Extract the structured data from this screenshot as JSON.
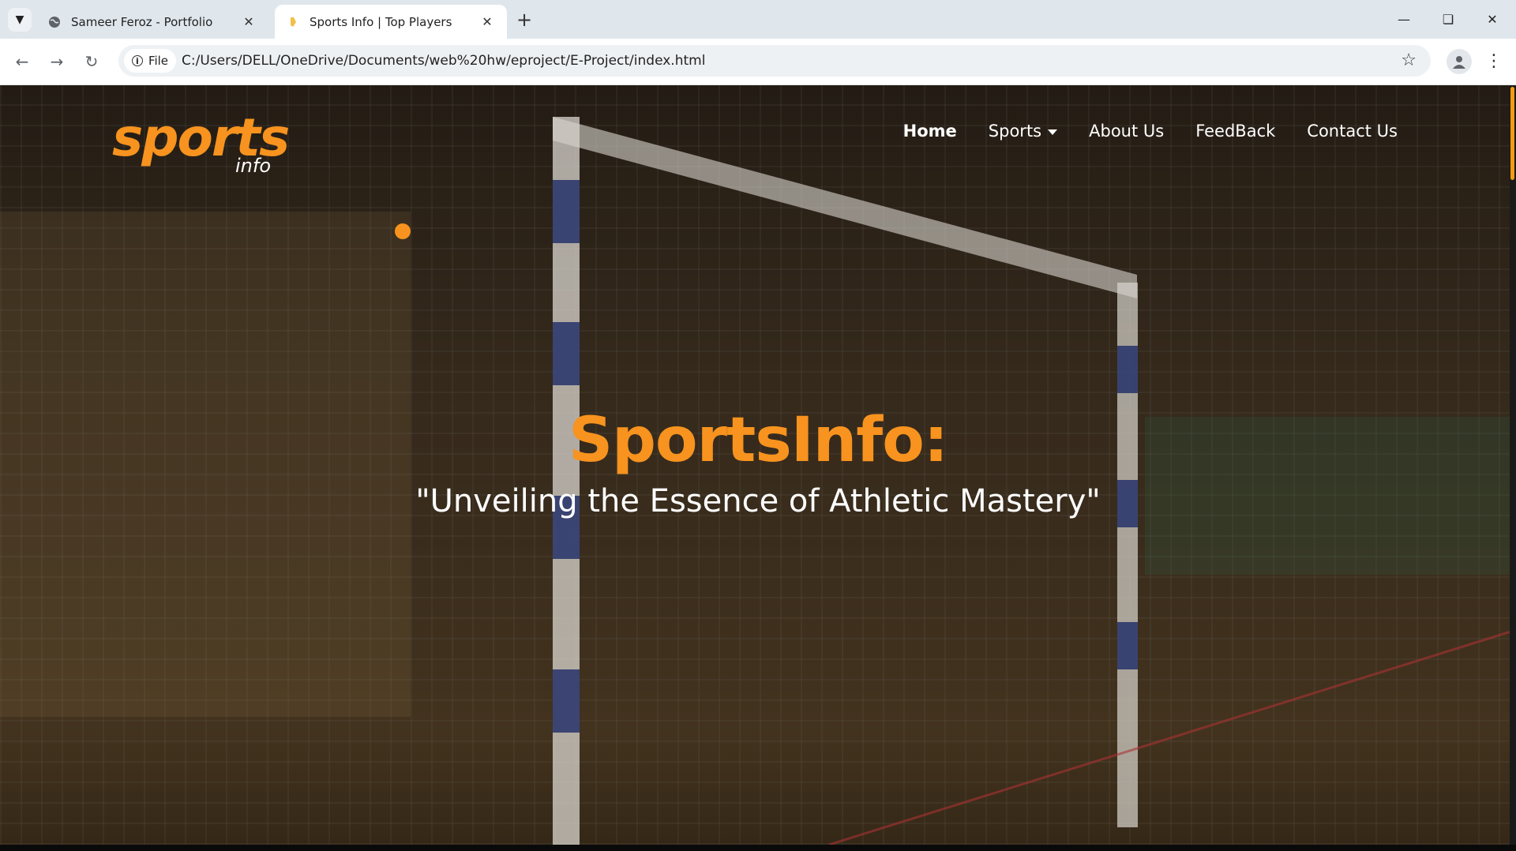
{
  "browser": {
    "tabs": [
      {
        "title": "Sameer Feroz - Portfolio",
        "active": false,
        "favicon": "globe-icon"
      },
      {
        "title": "Sports Info | Top Players",
        "active": true,
        "favicon": "sports-favicon"
      }
    ],
    "site_chip": "File",
    "url": "C:/Users/DELL/OneDrive/Documents/web%20hw/eproject/E-Project/index.html"
  },
  "page": {
    "logo": {
      "word": "sports",
      "sub": "info"
    },
    "nav": [
      {
        "label": "Home",
        "active": true
      },
      {
        "label": "Sports",
        "dropdown": true
      },
      {
        "label": "About Us"
      },
      {
        "label": "FeedBack"
      },
      {
        "label": "Contact Us"
      }
    ],
    "hero": {
      "title": "SportsInfo:",
      "subtitle": "\"Unveiling the Essence of Athletic Mastery\""
    }
  },
  "colors": {
    "accent": "#f7931e",
    "nav_text": "#ffffff",
    "tabbar_bg": "#dfe6ec"
  }
}
